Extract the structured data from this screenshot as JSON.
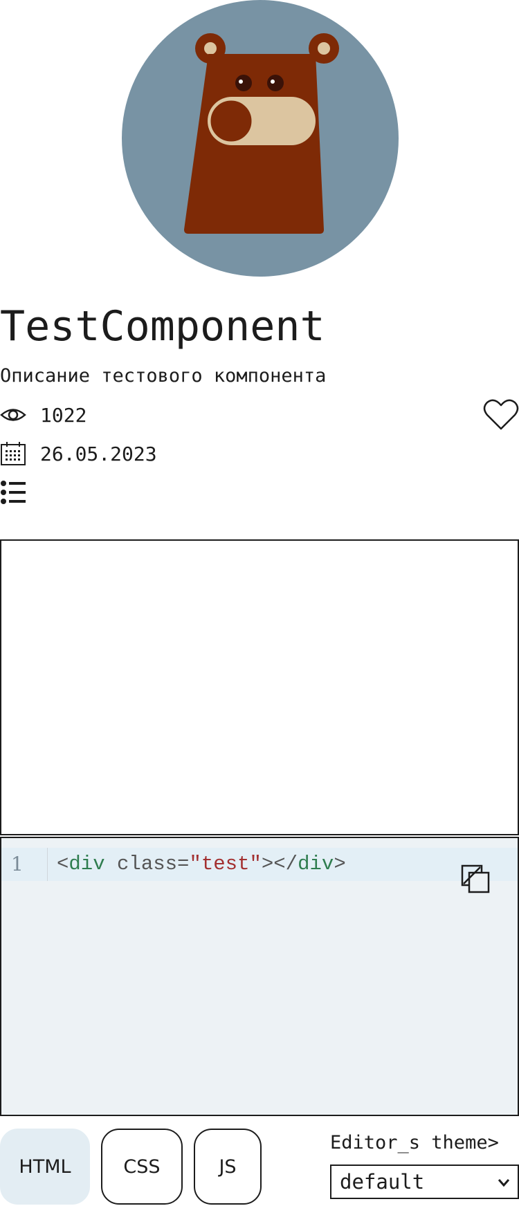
{
  "component": {
    "title": "TestComponent",
    "description": "Описание тестового компонента",
    "views": "1022",
    "date": "26.05.2023"
  },
  "editor": {
    "line_number": "1",
    "code_tokens": {
      "open_bracket": "<",
      "tag_open": "div",
      "attr": " class=",
      "string": "\"test\"",
      "close_open": "></",
      "tag_close": "div",
      "end": ">"
    }
  },
  "tabs": [
    "HTML",
    "CSS",
    "JS"
  ],
  "active_tab": "HTML",
  "theme": {
    "label": "Editor_s theme>",
    "selected": "default"
  },
  "icons": {
    "views": "eye-icon",
    "date": "calendar-icon",
    "list": "list-icon",
    "like": "heart-icon",
    "copy": "copy-icon",
    "select": "chevron-down-icon"
  },
  "colors": {
    "avatar_bg": "#7893a4",
    "bear_body": "#7e2a06",
    "bear_muzzle": "#dcc5a0",
    "editor_bg": "#edf2f5",
    "active_tab_bg": "#e3edf3"
  }
}
